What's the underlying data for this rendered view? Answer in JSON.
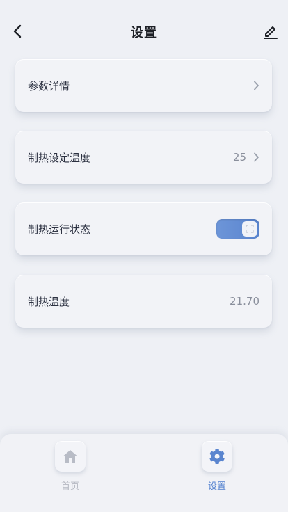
{
  "header": {
    "title": "设置",
    "back_icon": "chevron-left-icon",
    "edit_icon": "pencil-icon"
  },
  "settings": [
    {
      "label": "参数详情",
      "value": "",
      "has_chevron": true
    },
    {
      "label": "制热设定温度",
      "value": "25",
      "has_chevron": true
    },
    {
      "label": "制热运行状态",
      "toggle": true,
      "toggle_on": true
    },
    {
      "label": "制热温度",
      "value": "21.70",
      "has_chevron": false
    }
  ],
  "bottom_nav": {
    "items": [
      {
        "label": "首页",
        "icon": "home-icon",
        "active": false
      },
      {
        "label": "设置",
        "icon": "gear-icon",
        "active": true
      }
    ]
  },
  "colors": {
    "background": "#eef0f5",
    "accent": "#5a85cf",
    "text": "#2b3040",
    "muted": "#8a8f9c"
  }
}
